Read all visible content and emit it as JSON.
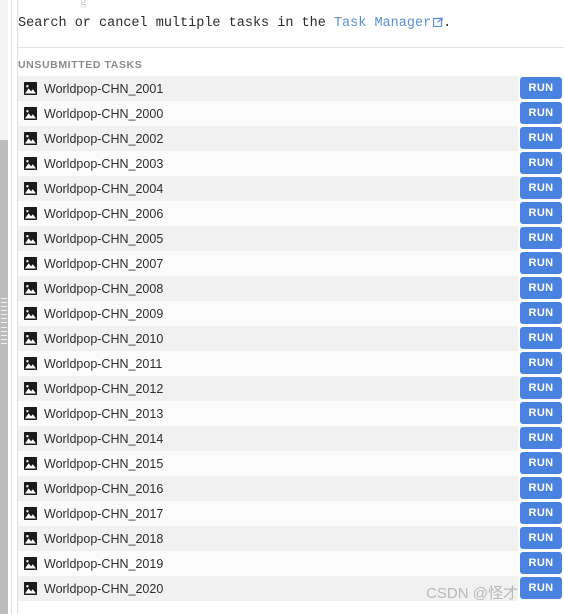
{
  "top_cut_text": "g",
  "intro": {
    "before": "Search or cancel multiple tasks in the ",
    "link_label": "Task Manager",
    "link_icon": "external-link-icon",
    "after": ".",
    "link_color": "#5a8fd6"
  },
  "section": {
    "label": "UNSUBMITTED TASKS"
  },
  "row_icon": "image-thumbnail-icon",
  "run_button_label": "RUN",
  "run_button_color": "#4a82e0",
  "tasks": [
    {
      "name": "Worldpop-CHN_2001"
    },
    {
      "name": "Worldpop-CHN_2000"
    },
    {
      "name": "Worldpop-CHN_2002"
    },
    {
      "name": "Worldpop-CHN_2003"
    },
    {
      "name": "Worldpop-CHN_2004"
    },
    {
      "name": "Worldpop-CHN_2006"
    },
    {
      "name": "Worldpop-CHN_2005"
    },
    {
      "name": "Worldpop-CHN_2007"
    },
    {
      "name": "Worldpop-CHN_2008"
    },
    {
      "name": "Worldpop-CHN_2009"
    },
    {
      "name": "Worldpop-CHN_2010"
    },
    {
      "name": "Worldpop-CHN_2011"
    },
    {
      "name": "Worldpop-CHN_2012"
    },
    {
      "name": "Worldpop-CHN_2013"
    },
    {
      "name": "Worldpop-CHN_2014"
    },
    {
      "name": "Worldpop-CHN_2015"
    },
    {
      "name": "Worldpop-CHN_2016"
    },
    {
      "name": "Worldpop-CHN_2017"
    },
    {
      "name": "Worldpop-CHN_2018"
    },
    {
      "name": "Worldpop-CHN_2019"
    },
    {
      "name": "Worldpop-CHN_2020"
    }
  ],
  "watermark": "CSDN @怪才"
}
